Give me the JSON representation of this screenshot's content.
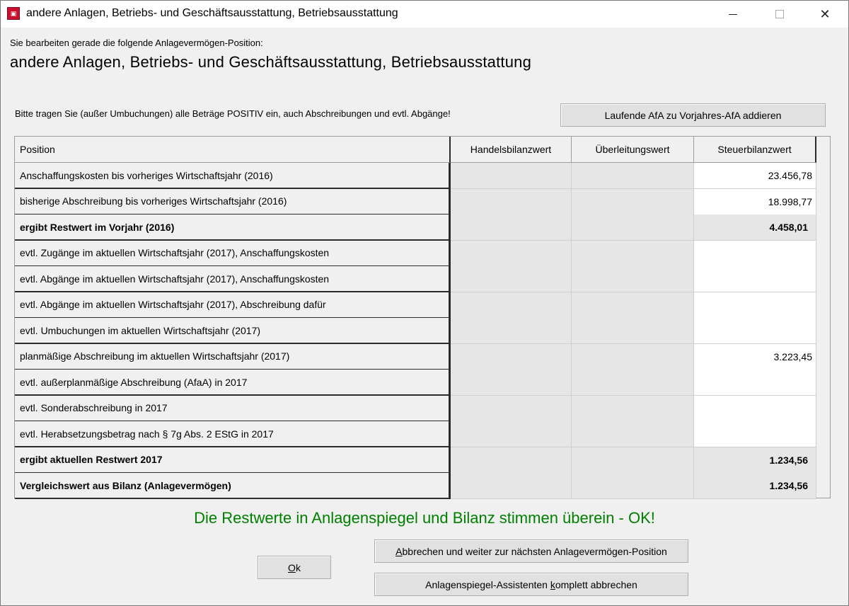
{
  "window": {
    "title": "andere Anlagen, Betriebs- und Geschäftsausstattung, Betriebsausstattung",
    "icon_label": "WinBil",
    "minimize_label": "—",
    "maximize_label": "☐",
    "close_label": "✕"
  },
  "editing_label": "Sie bearbeiten gerade die folgende Anlagevermögen-Position:",
  "position_name": "andere Anlagen, Betriebs- und Geschäftsausstattung, Betriebsausstattung",
  "hint": "Bitte tragen Sie (außer Umbuchungen) alle Beträge POSITIV ein, auch Abschreibungen und evtl. Abgänge!",
  "buttons": {
    "afa_add": "Laufende AfA zu Vorjahres-AfA addieren",
    "skip_next": "Abbrechen und weiter zur nächsten Anlagevermögen-Position",
    "ok": "Ok",
    "abort_all": "Anlagenspiegel-Assistenten komplett abbrechen"
  },
  "table": {
    "columns": [
      "Position",
      "Handelsbilanzwert",
      "Überleitungswert",
      "Steuerbilanzwert"
    ],
    "rows": [
      {
        "label": "Anschaffungskosten bis vorheriges Wirtschaftsjahr (2016)",
        "handel": "",
        "ueberleitung": "",
        "steuer": "23.456,78",
        "bold": false,
        "readonly": false
      },
      {
        "label": "bisherige Abschreibung bis vorheriges Wirtschaftsjahr (2016)",
        "handel": "",
        "ueberleitung": "",
        "steuer": "18.998,77",
        "bold": false,
        "readonly": false
      },
      {
        "label": "ergibt Restwert im Vorjahr (2016)",
        "handel": "",
        "ueberleitung": "",
        "steuer": "4.458,01",
        "bold": true,
        "readonly": true
      },
      {
        "label": "evtl. Zugänge im aktuellen Wirtschaftsjahr (2017), Anschaffungskosten",
        "handel": "",
        "ueberleitung": "",
        "steuer": "",
        "bold": false,
        "readonly": false
      },
      {
        "label": "evtl. Abgänge im aktuellen Wirtschaftsjahr (2017), Anschaffungskosten",
        "handel": "",
        "ueberleitung": "",
        "steuer": "",
        "bold": false,
        "readonly": false
      },
      {
        "label": "evtl. Abgänge im aktuellen Wirtschaftsjahr (2017), Abschreibung dafür",
        "handel": "",
        "ueberleitung": "",
        "steuer": "",
        "bold": false,
        "readonly": false
      },
      {
        "label": "evtl. Umbuchungen im aktuellen Wirtschaftsjahr (2017)",
        "handel": "",
        "ueberleitung": "",
        "steuer": "",
        "bold": false,
        "readonly": false
      },
      {
        "label": "planmäßige Abschreibung im aktuellen Wirtschaftsjahr (2017)",
        "handel": "",
        "ueberleitung": "",
        "steuer": "3.223,45",
        "bold": false,
        "readonly": false
      },
      {
        "label": "evtl. außerplanmäßige Abschreibung (AfaA) in 2017",
        "handel": "",
        "ueberleitung": "",
        "steuer": "",
        "bold": false,
        "readonly": false
      },
      {
        "label": "evtl. Sonderabschreibung in 2017",
        "handel": "",
        "ueberleitung": "",
        "steuer": "",
        "bold": false,
        "readonly": false
      },
      {
        "label": "evtl. Herabsetzungsbetrag nach § 7g Abs. 2 EStG in 2017",
        "handel": "",
        "ueberleitung": "",
        "steuer": "",
        "bold": false,
        "readonly": false
      },
      {
        "label": "ergibt aktuellen Restwert 2017",
        "handel": "",
        "ueberleitung": "",
        "steuer": "1.234,56",
        "bold": true,
        "readonly": true
      },
      {
        "label": "Vergleichswert aus Bilanz (Anlagevermögen)",
        "handel": "",
        "ueberleitung": "",
        "steuer": "1.234,56",
        "bold": true,
        "readonly": true
      }
    ]
  },
  "status_message": "Die Restwerte in Anlagenspiegel und Bilanz stimmen überein - OK!",
  "colors": {
    "status_ok": "#008000",
    "app_icon": "#c8102e"
  }
}
